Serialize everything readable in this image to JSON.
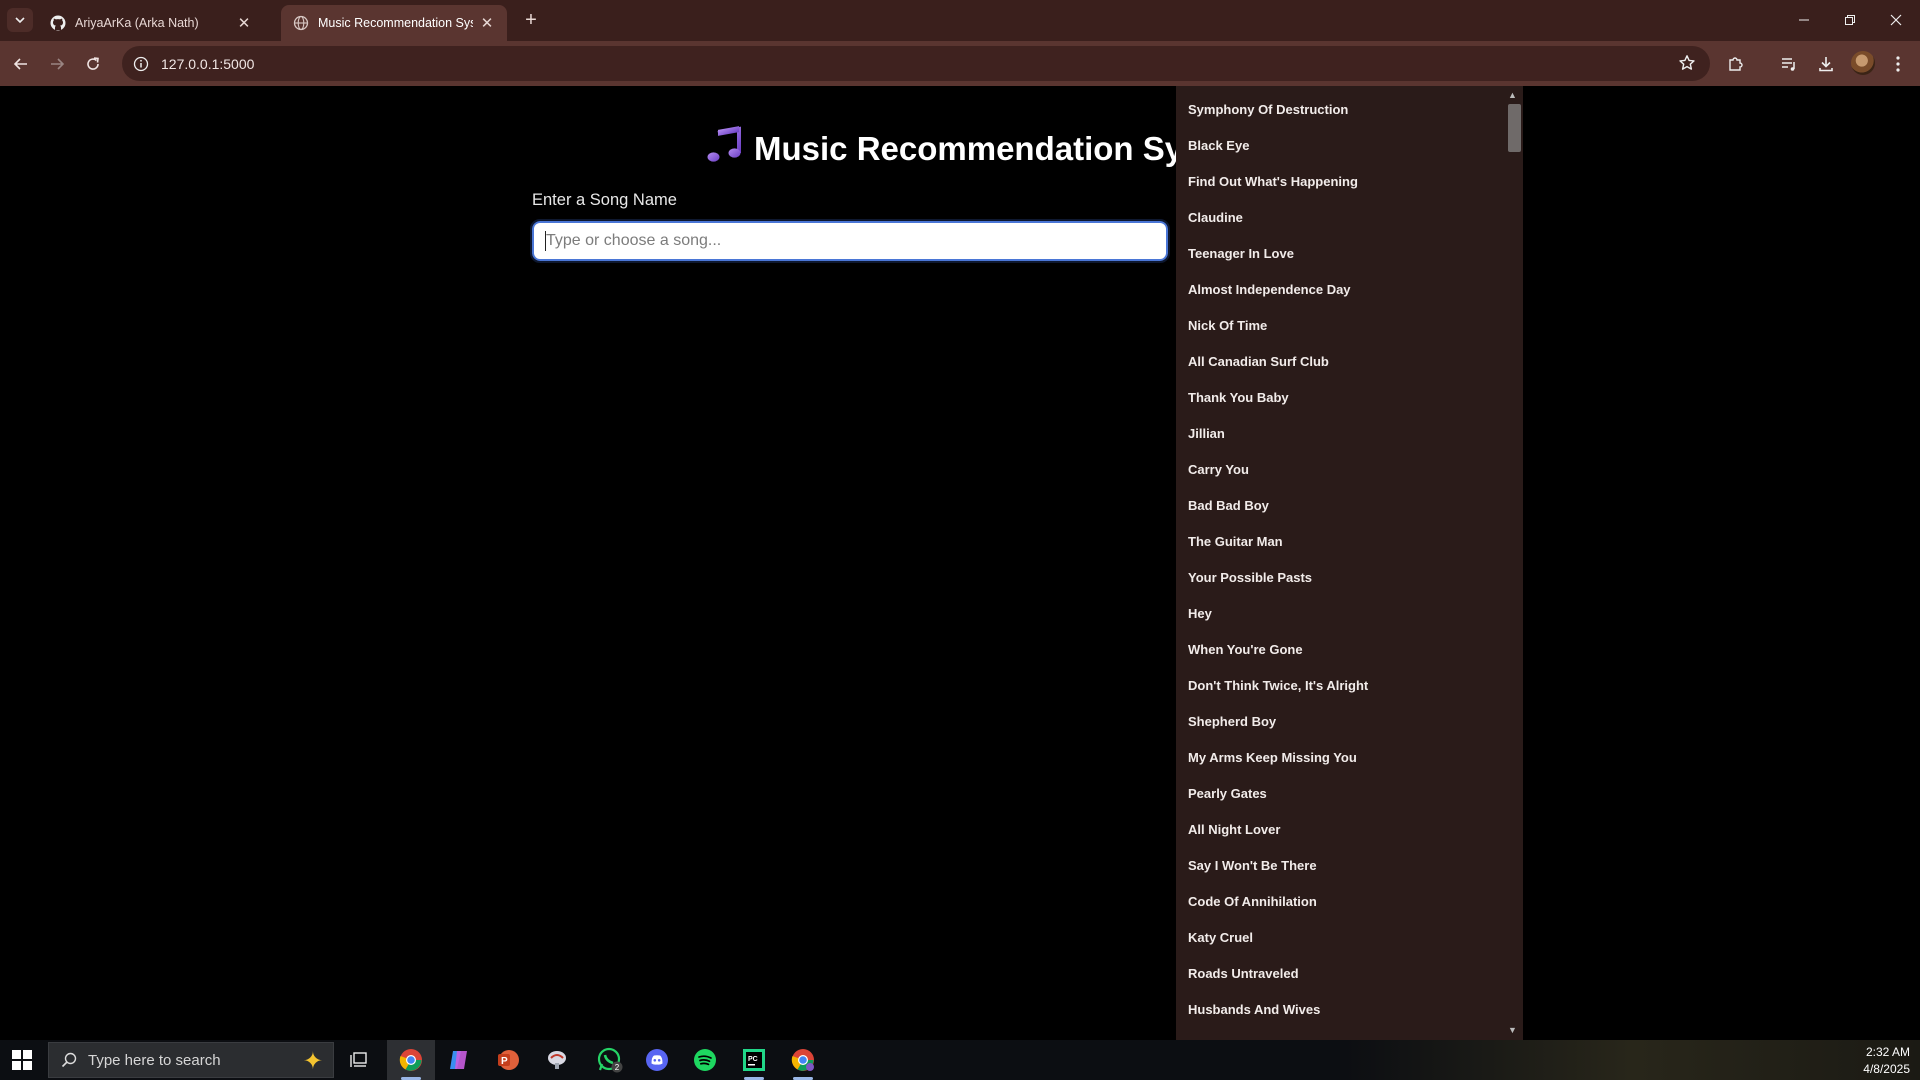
{
  "browser": {
    "tabs": [
      {
        "title": "AriyaArKa (Arka Nath)",
        "icon": "github-icon",
        "active": false
      },
      {
        "title": "Music Recommendation System",
        "icon": "globe-icon",
        "active": true
      }
    ],
    "url": "127.0.0.1:5000"
  },
  "page": {
    "heading_icon": "🎵",
    "heading": "Music Recommendation System",
    "label": "Enter a Song Name",
    "input_value": "",
    "input_placeholder": "Type or choose a song..."
  },
  "dropdown": {
    "options": [
      "Symphony Of Destruction",
      "Black Eye",
      "Find Out What's Happening",
      "Claudine",
      "Teenager In Love",
      "Almost Independence Day",
      "Nick Of Time",
      "All Canadian Surf Club",
      "Thank You Baby",
      "Jillian",
      "Carry You",
      "Bad Bad Boy",
      "The Guitar Man",
      "Your Possible Pasts",
      "Hey",
      "When You're Gone",
      "Don't Think Twice, It's Alright",
      "Shepherd Boy",
      "My Arms Keep Missing You",
      "Pearly Gates",
      "All Night Lover",
      "Say I Won't Be There",
      "Code Of Annihilation",
      "Katy Cruel",
      "Roads Untraveled",
      "Husbands And Wives"
    ]
  },
  "taskbar": {
    "search_placeholder": "Type here to search",
    "whatsapp_badge": "2",
    "time": "2:32 AM",
    "date": "4/8/2025"
  },
  "colors": {
    "chrome_tabbar": "#3a1f1c",
    "chrome_toolbar": "#5a3530",
    "input_border": "#4a76d6",
    "dropdown_bg": "#2a1b19"
  }
}
